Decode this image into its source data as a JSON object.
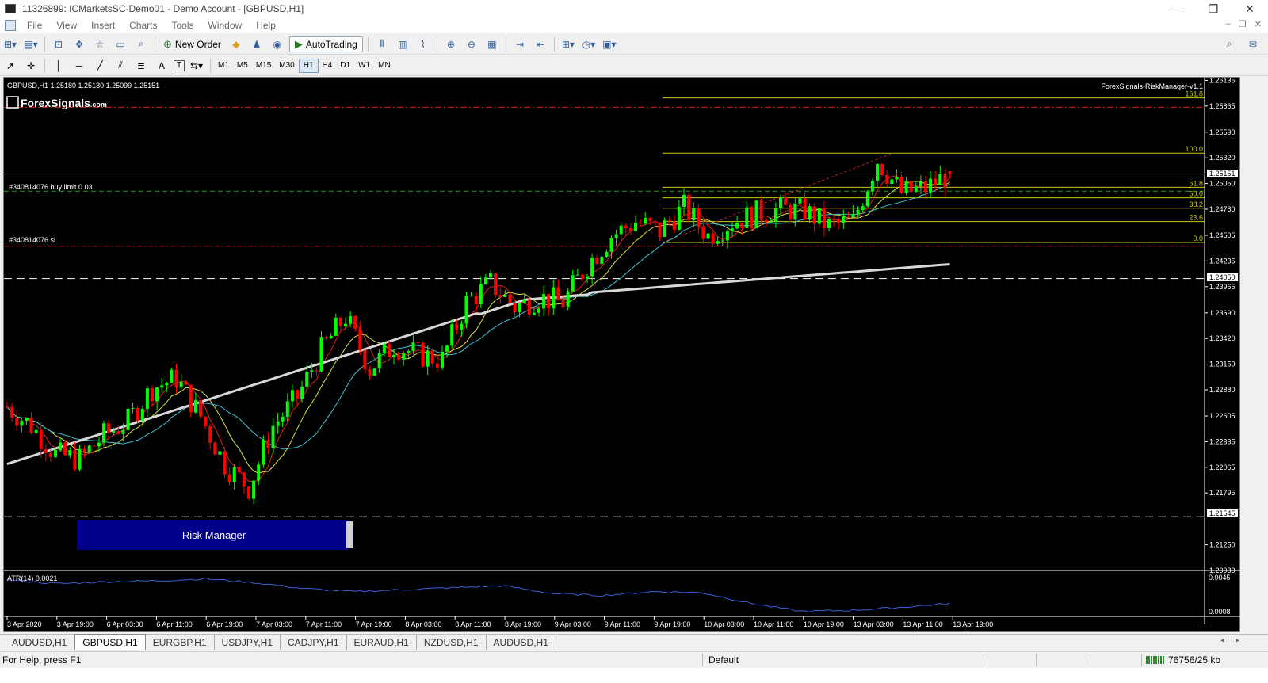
{
  "window": {
    "title": "11326899: ICMarketsSC-Demo01 - Demo Account - [GBPUSD,H1]",
    "minimize": "—",
    "restore": "❐",
    "close": "✕"
  },
  "menu": {
    "items": [
      "File",
      "View",
      "Insert",
      "Charts",
      "Tools",
      "Window",
      "Help"
    ],
    "mdi": [
      "–",
      "❐",
      "✕"
    ]
  },
  "toolbar": {
    "new_order": "New Order",
    "auto_trading": "AutoTrading",
    "timeframes": [
      "M1",
      "M5",
      "M15",
      "M30",
      "H1",
      "H4",
      "D1",
      "W1",
      "MN"
    ],
    "active_timeframe": "H1",
    "text_tool": "A",
    "label_tool": "T"
  },
  "chart": {
    "header": "GBPUSD,H1  1.25180 1.25180 1.25099 1.25151",
    "brand": "ForexSignals",
    "brand_suffix": ".com",
    "ea_name": "ForexSignals-RiskManager-v1.1",
    "buy_limit_label": "#340814076 buy limit 0.03",
    "sl_label": "#340814076 sl",
    "risk_button": "Risk Manager",
    "price_labels": [
      "1.26135",
      "1.25865",
      "1.25590",
      "1.25320",
      "1.25050",
      "1.24780",
      "1.24505",
      "1.24235",
      "1.23965",
      "1.23690",
      "1.23420",
      "1.23150",
      "1.22880",
      "1.22605",
      "1.22335",
      "1.22065",
      "1.21795",
      "1.21250",
      "1.20980"
    ],
    "current_price": "1.25151",
    "hline_upper": "1.24050",
    "hline_lower": "1.21545",
    "fib_levels": [
      {
        "label": "161.8",
        "price": 1.2595
      },
      {
        "label": "100.0",
        "price": 1.2537
      },
      {
        "label": "61.8",
        "price": 1.2501
      },
      {
        "label": "50.0",
        "price": 1.249
      },
      {
        "label": "38.2",
        "price": 1.2479
      },
      {
        "label": "23.6",
        "price": 1.2465
      },
      {
        "label": "0.0",
        "price": 1.2443
      }
    ],
    "time_labels": [
      "3 Apr 2020",
      "3 Apr 19:00",
      "6 Apr 03:00",
      "6 Apr 11:00",
      "6 Apr 19:00",
      "7 Apr 03:00",
      "7 Apr 11:00",
      "7 Apr 19:00",
      "8 Apr 03:00",
      "8 Apr 11:00",
      "8 Apr 19:00",
      "9 Apr 03:00",
      "9 Apr 11:00",
      "9 Apr 19:00",
      "10 Apr 03:00",
      "10 Apr 11:00",
      "10 Apr 19:00",
      "13 Apr 03:00",
      "13 Apr 11:00",
      "13 Apr 19:00"
    ],
    "indicator_label": "ATR(14) 0.0021",
    "indicator_scale": [
      "0.0045",
      "0.0008"
    ],
    "colors": {
      "bull": "#00ff00",
      "bear": "#ff0000",
      "fib": "#c8c81e",
      "atr": "#3b5fd8",
      "risk_button": "#00008b"
    }
  },
  "chart_data": {
    "type": "candlestick",
    "symbol": "GBPUSD",
    "timeframe": "H1",
    "ylim": [
      1.2098,
      1.2613
    ],
    "open": 1.2518,
    "high": 1.2518,
    "low": 1.25099,
    "close": 1.25151,
    "waypoints": [
      1.227,
      1.225,
      1.222,
      1.2215,
      1.224,
      1.2255,
      1.229,
      1.23,
      1.226,
      1.221,
      1.2185,
      1.225,
      1.228,
      1.233,
      1.2365,
      1.231,
      1.2335,
      1.2325,
      1.232,
      1.238,
      1.24,
      1.2375,
      1.2385,
      1.238,
      1.242,
      1.245,
      1.2465,
      1.2455,
      1.248,
      1.245,
      1.2465,
      1.2473,
      1.2478,
      1.2476,
      1.246,
      1.2465,
      1.253,
      1.2495,
      1.25,
      1.2515
    ],
    "atr_level": [
      0.0042,
      0.0038,
      0.004,
      0.0041,
      0.0043,
      0.0039,
      0.0033,
      0.003,
      0.0032,
      0.0034,
      0.0036,
      0.0028,
      0.0026,
      0.003,
      0.0029,
      0.0018,
      0.001,
      0.0011,
      0.0014,
      0.0018
    ]
  },
  "tabs": [
    "AUDUSD,H1",
    "GBPUSD,H1",
    "EURGBP,H1",
    "USDJPY,H1",
    "CADJPY,H1",
    "EURAUD,H1",
    "NZDUSD,H1",
    "AUDUSD,H1"
  ],
  "active_tab": 1,
  "status": {
    "help": "For Help, press F1",
    "profile": "Default",
    "traffic": "76756/25 kb"
  }
}
